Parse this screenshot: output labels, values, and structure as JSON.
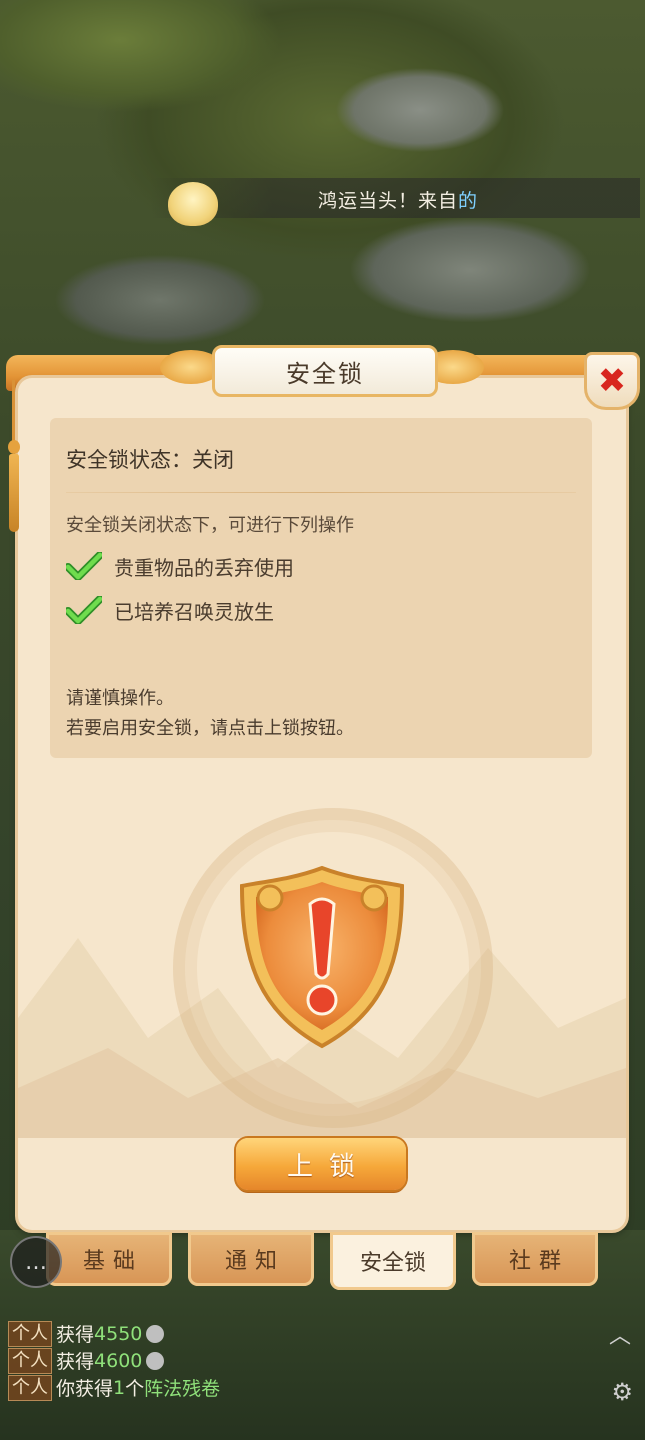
{
  "banner": {
    "text": "鸿运当头！来自",
    "text_tail": "的"
  },
  "dialog": {
    "title": "安全锁",
    "close_glyph": "✖",
    "status_label": "安全锁状态：关闭",
    "description": "安全锁关闭状态下，可进行下列操作",
    "permissions": [
      "贵重物品的丢弃使用",
      "已培养召唤灵放生"
    ],
    "notes": [
      "请谨慎操作。",
      "若要启用安全锁，请点击上锁按钮。"
    ],
    "emblem_icon": "warning-shield-icon",
    "lock_button": "上锁"
  },
  "tabs": [
    {
      "label": "基础",
      "active": false
    },
    {
      "label": "通知",
      "active": false
    },
    {
      "label": "安全锁",
      "active": true
    },
    {
      "label": "社群",
      "active": false
    }
  ],
  "chat": {
    "rows": [
      {
        "tag": "个人",
        "prefix": "获得",
        "value": "4550",
        "suffix": ""
      },
      {
        "tag": "个人",
        "prefix": "获得",
        "value": "4600",
        "suffix": ""
      },
      {
        "tag": "个人",
        "prefix": "你获得",
        "value": "1",
        "suffix": "个",
        "item": "阵法残卷"
      }
    ]
  },
  "colors": {
    "accent_orange": "#f6a83a",
    "panel_bg": "#f6e6cc",
    "close_red": "#d8261e",
    "check_green": "#4cc23a",
    "chat_green": "#8fe07a"
  }
}
